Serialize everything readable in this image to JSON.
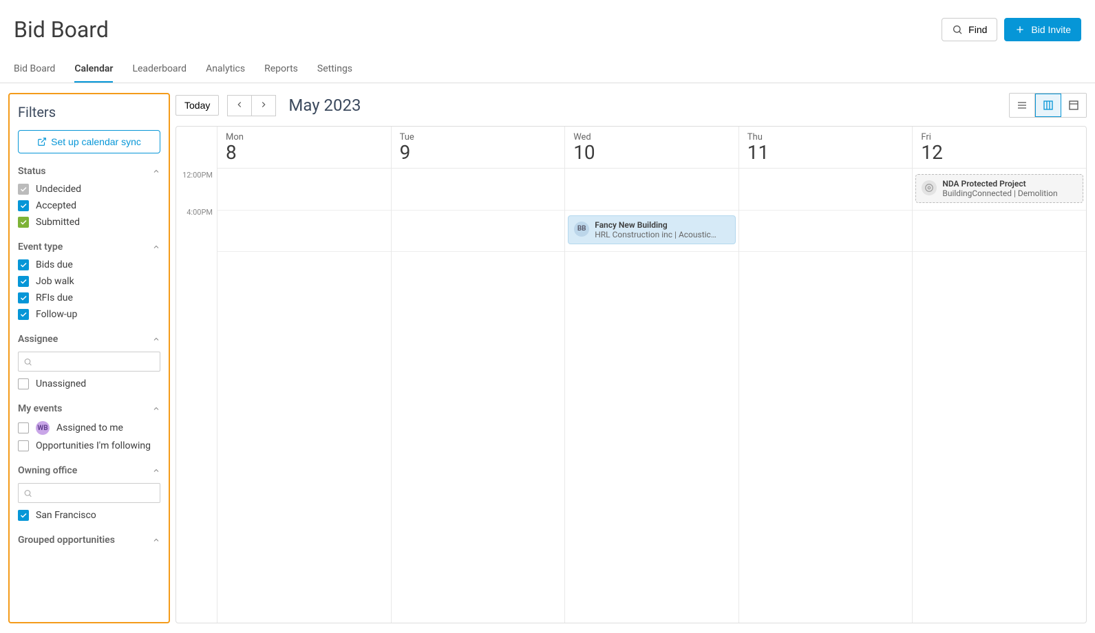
{
  "header": {
    "title": "Bid Board",
    "find_label": "Find",
    "invite_label": "Bid Invite"
  },
  "tabs": [
    "Bid Board",
    "Calendar",
    "Leaderboard",
    "Analytics",
    "Reports",
    "Settings"
  ],
  "active_tab": "Calendar",
  "filters": {
    "title": "Filters",
    "sync_label": "Set up calendar sync",
    "status": {
      "title": "Status",
      "items": [
        {
          "label": "Undecided",
          "style": "checked-gray"
        },
        {
          "label": "Accepted",
          "style": "checked-blue"
        },
        {
          "label": "Submitted",
          "style": "checked-green"
        }
      ]
    },
    "event_type": {
      "title": "Event type",
      "items": [
        "Bids due",
        "Job walk",
        "RFIs due",
        "Follow-up"
      ]
    },
    "assignee": {
      "title": "Assignee",
      "unassigned_label": "Unassigned"
    },
    "my_events": {
      "title": "My events",
      "avatar": "WB",
      "assigned_label": "Assigned to me",
      "following_label": "Opportunities I'm following"
    },
    "owning_office": {
      "title": "Owning office",
      "items": [
        "San Francisco"
      ]
    },
    "grouped": {
      "title": "Grouped opportunities"
    }
  },
  "calendar": {
    "today_label": "Today",
    "month_label": "May 2023",
    "time_labels": [
      "12:00PM",
      "4:00PM"
    ],
    "days": [
      {
        "name": "Mon",
        "num": "8"
      },
      {
        "name": "Tue",
        "num": "9"
      },
      {
        "name": "Wed",
        "num": "10"
      },
      {
        "name": "Thu",
        "num": "11"
      },
      {
        "name": "Fri",
        "num": "12"
      }
    ],
    "events": {
      "wed": {
        "avatar": "BB",
        "title": "Fancy New Building",
        "sub": "HRL Construction inc  |  Acoustic…"
      },
      "fri": {
        "title": "NDA Protected Project",
        "sub": "BuildingConnected  |  Demolition"
      }
    }
  }
}
